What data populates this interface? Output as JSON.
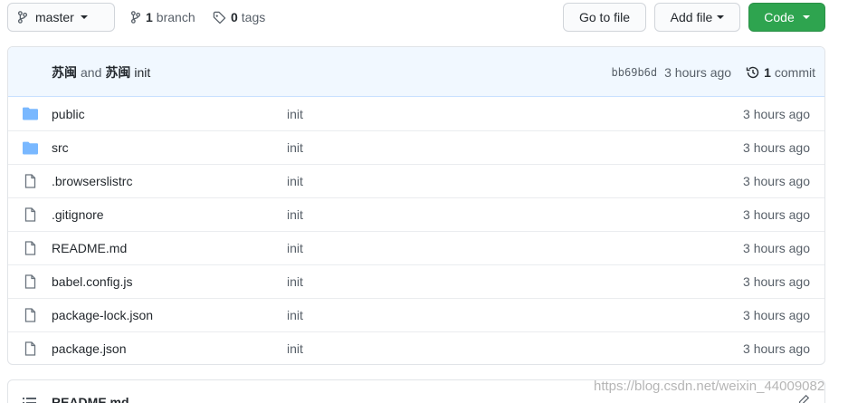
{
  "toolbar": {
    "branch_label": "master",
    "branch_count": "1",
    "branch_word": "branch",
    "tag_count": "0",
    "tag_word": "tags",
    "go_to_file": "Go to file",
    "add_file": "Add file",
    "code": "Code"
  },
  "commit": {
    "author1": "苏闽",
    "and_word": "and",
    "author2": "苏闽",
    "message": "init",
    "sha": "bb69b6d",
    "time": "3 hours ago",
    "count": "1",
    "count_word": "commit"
  },
  "files": [
    {
      "name": "public",
      "type": "folder",
      "message": "init",
      "age": "3 hours ago"
    },
    {
      "name": "src",
      "type": "folder",
      "message": "init",
      "age": "3 hours ago"
    },
    {
      "name": ".browserslistrc",
      "type": "file",
      "message": "init",
      "age": "3 hours ago"
    },
    {
      "name": ".gitignore",
      "type": "file",
      "message": "init",
      "age": "3 hours ago"
    },
    {
      "name": "README.md",
      "type": "file",
      "message": "init",
      "age": "3 hours ago"
    },
    {
      "name": "babel.config.js",
      "type": "file",
      "message": "init",
      "age": "3 hours ago"
    },
    {
      "name": "package-lock.json",
      "type": "file",
      "message": "init",
      "age": "3 hours ago"
    },
    {
      "name": "package.json",
      "type": "file",
      "message": "init",
      "age": "3 hours ago"
    }
  ],
  "readme": {
    "title": "README.md"
  },
  "watermark": "https://blog.csdn.net/weixin_44009082",
  "colors": {
    "code_button": "#2ea44f",
    "commit_bar": "#f1f8ff",
    "folder_icon": "#79b8ff"
  }
}
